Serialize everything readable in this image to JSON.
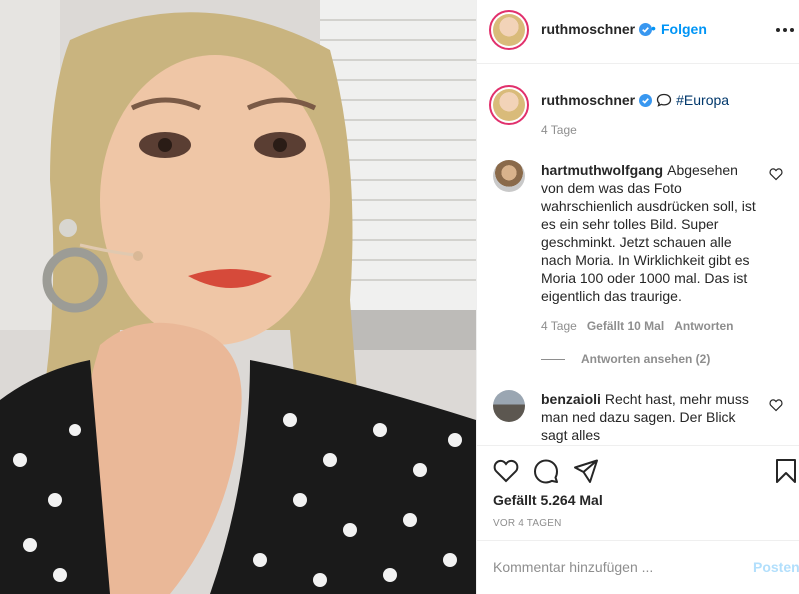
{
  "post": {
    "author": "ruthmoschner",
    "follow_separator": "•",
    "follow_label": "Folgen",
    "more_icon": "more-icon",
    "verified_color": "#3897f0"
  },
  "caption": {
    "author": "ruthmoschner",
    "hashtag": "#Europa",
    "time": "4 Tage"
  },
  "comments": [
    {
      "username": "hartmuthwolfgang",
      "text": "Abgesehen von dem was das Foto wahrschienlich ausdrücken soll, ist es ein sehr tolles Bild. Super geschminkt. Jetzt schauen alle nach Moria. In Wirklichkeit gibt es Moria 100 oder 1000 mal. Das ist eigentlich das traurige.",
      "time": "4 Tage",
      "likes": "Gefällt 10 Mal",
      "reply": "Antworten",
      "view_replies": "Antworten ansehen (2)"
    },
    {
      "username": "benzaioli",
      "text": "Recht hast, mehr muss man ned dazu sagen. Der Blick sagt alles"
    }
  ],
  "actions": {
    "likes": "Gefällt 5.264 Mal",
    "date": "VOR 4 TAGEN"
  },
  "add_comment": {
    "placeholder": "Kommentar hinzufügen ...",
    "post_label": "Posten"
  },
  "colors": {
    "link": "#0095f6",
    "hashtag": "#00376b",
    "muted": "#8e8e8e",
    "story_ring": "#e1306c"
  }
}
